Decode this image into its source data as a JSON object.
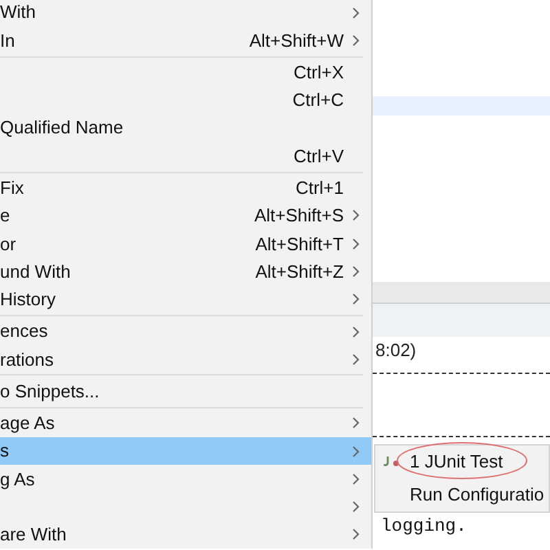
{
  "context_menu": {
    "items": [
      {
        "kind": "item",
        "label": "With",
        "submenu": true,
        "selected": false
      },
      {
        "kind": "item",
        "label": "In",
        "shortcut": "Alt+Shift+W",
        "submenu": true,
        "selected": false
      },
      {
        "kind": "separator"
      },
      {
        "kind": "item",
        "shortcut": "Ctrl+X",
        "submenu": false,
        "selected": false
      },
      {
        "kind": "item",
        "shortcut": "Ctrl+C",
        "submenu": false,
        "selected": false
      },
      {
        "kind": "item",
        "label": "Qualified Name",
        "submenu": false,
        "selected": false
      },
      {
        "kind": "item",
        "shortcut": "Ctrl+V",
        "submenu": false,
        "selected": false
      },
      {
        "kind": "separator"
      },
      {
        "kind": "item",
        "label": "Fix",
        "shortcut": "Ctrl+1",
        "submenu": false,
        "selected": false
      },
      {
        "kind": "item",
        "label": "e",
        "shortcut": "Alt+Shift+S",
        "submenu": true,
        "selected": false
      },
      {
        "kind": "item",
        "label": "or",
        "shortcut": "Alt+Shift+T",
        "submenu": true,
        "selected": false
      },
      {
        "kind": "item",
        "label": "und With",
        "shortcut": "Alt+Shift+Z",
        "submenu": true,
        "selected": false
      },
      {
        "kind": "item",
        "label": "History",
        "submenu": true,
        "selected": false
      },
      {
        "kind": "separator"
      },
      {
        "kind": "item",
        "label": "ences",
        "submenu": true,
        "selected": false
      },
      {
        "kind": "item",
        "label": "rations",
        "submenu": true,
        "selected": false
      },
      {
        "kind": "separator"
      },
      {
        "kind": "item",
        "label": "o Snippets...",
        "submenu": false,
        "selected": false
      },
      {
        "kind": "separator"
      },
      {
        "kind": "item",
        "label": "age As",
        "submenu": true,
        "selected": false
      },
      {
        "kind": "item",
        "label": "s",
        "submenu": true,
        "selected": true
      },
      {
        "kind": "item",
        "label": "g As",
        "submenu": true,
        "selected": false
      },
      {
        "kind": "item",
        "submenu": true,
        "selected": false
      },
      {
        "kind": "item",
        "label": "are With",
        "submenu": true,
        "selected": false
      }
    ]
  },
  "console": {
    "header": "8:02)",
    "text": "logging."
  },
  "submenu": {
    "items": [
      {
        "label": "1 JUnit Test",
        "icon": true,
        "circled": true
      },
      {
        "label": "Run Configuratio",
        "icon": false,
        "circled": false
      }
    ]
  }
}
